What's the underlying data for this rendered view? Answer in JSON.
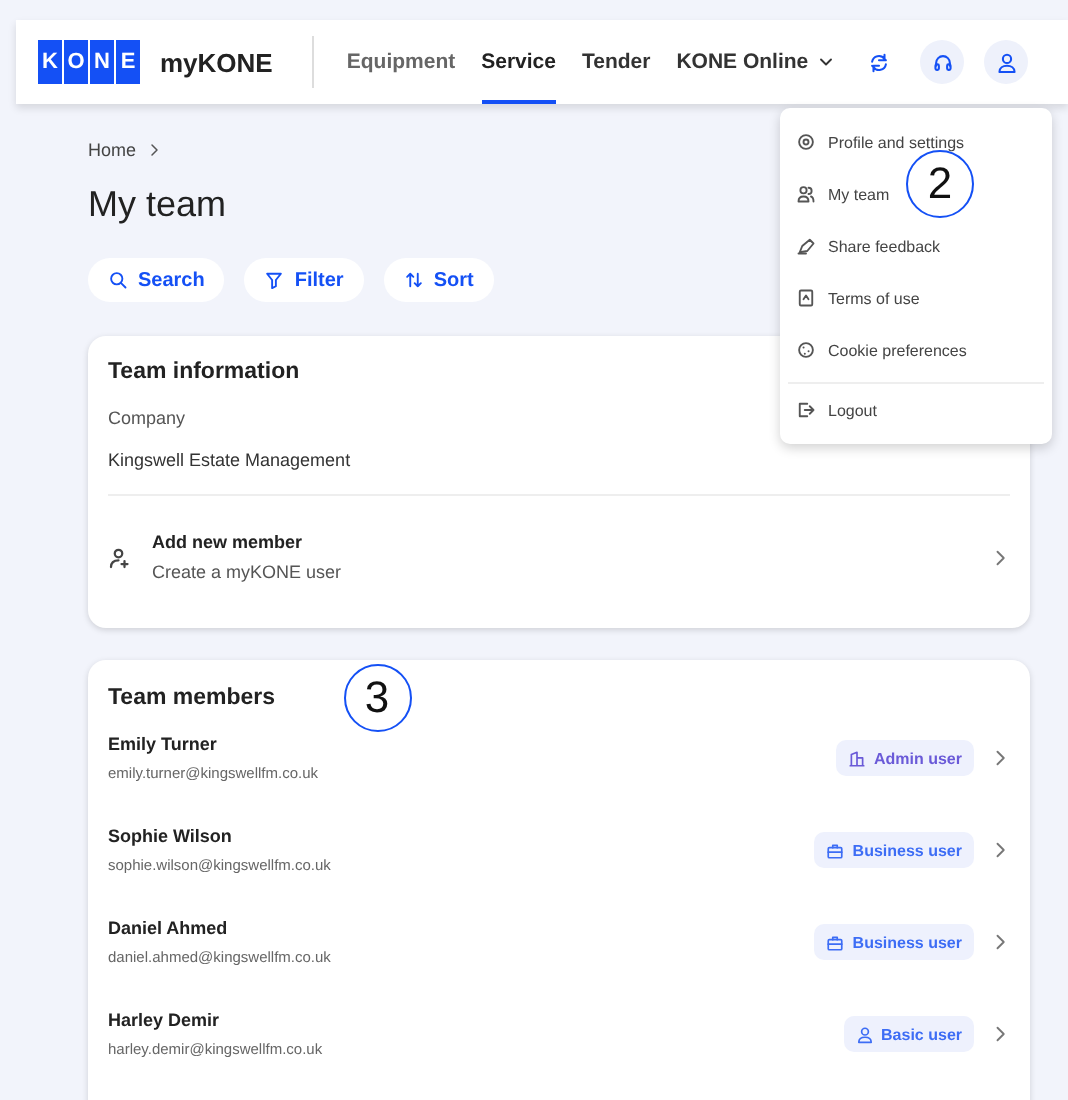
{
  "header": {
    "logo_letters": [
      "K",
      "O",
      "N",
      "E"
    ],
    "app_name": "myKONE",
    "nav": [
      {
        "label": "Equipment",
        "selected": false
      },
      {
        "label": "Service",
        "selected": true
      },
      {
        "label": "Tender",
        "selected": false
      },
      {
        "label": "KONE Online",
        "selected": false,
        "kind": "dropdown"
      }
    ]
  },
  "user_menu": {
    "items": [
      {
        "label": "Profile and settings",
        "kind": "settings"
      },
      {
        "label": "My team",
        "kind": "team"
      },
      {
        "label": "Share feedback",
        "kind": "feedback"
      },
      {
        "label": "Terms of use",
        "kind": "terms"
      },
      {
        "label": "Cookie preferences",
        "kind": "cookie"
      }
    ],
    "logout": "Logout",
    "callout": "2"
  },
  "breadcrumb": [
    "Home"
  ],
  "title": "My team",
  "actions": [
    {
      "label": "Search",
      "kind": "search"
    },
    {
      "label": "Filter",
      "kind": "filter"
    },
    {
      "label": "Sort",
      "kind": "sort"
    }
  ],
  "team_information": {
    "title": "Team information",
    "company_label": "Company",
    "company": "Kingswell Estate Management",
    "add_member": {
      "title": "Add new member",
      "subtitle": "Create a myKONE user"
    }
  },
  "team_members": {
    "title": "Team members",
    "callout": "3",
    "members": [
      {
        "name": "Emily Turner",
        "email": "emily.turner@kingswellfm.co.uk",
        "role": "Admin user",
        "kind": "admin"
      },
      {
        "name": "Sophie Wilson",
        "email": "sophie.wilson@kingswellfm.co.uk",
        "role": "Business user",
        "kind": "business"
      },
      {
        "name": "Daniel Ahmed",
        "email": "daniel.ahmed@kingswellfm.co.uk",
        "role": "Business user",
        "kind": "business"
      },
      {
        "name": "Harley Demir",
        "email": "harley.demir@kingswellfm.co.uk",
        "role": "Basic user",
        "kind": "basic"
      }
    ]
  }
}
